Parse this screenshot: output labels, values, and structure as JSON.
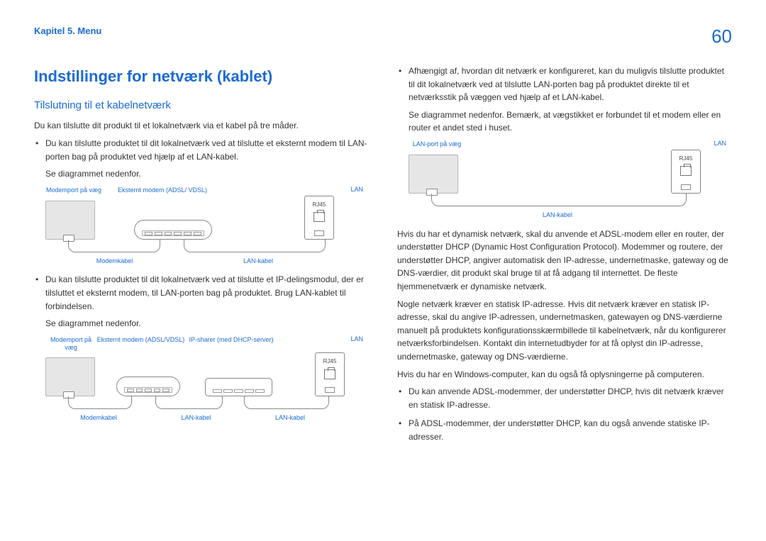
{
  "header": {
    "chapter": "Kapitel 5. Menu",
    "page": "60"
  },
  "left": {
    "h1": "Indstillinger for netværk (kablet)",
    "h2": "Tilslutning til et kabelnetværk",
    "intro": "Du kan tilslutte dit produkt til et lokalnetværk via et kabel på tre måder.",
    "b1": "Du kan tilslutte produktet til dit lokalnetværk ved at tilslutte et eksternt modem til LAN-porten bag på produktet ved hjælp af et LAN-kabel.",
    "see1": "Se diagrammet nedenfor.",
    "d1": {
      "wall": "Modemport på væg",
      "modem": "Eksternt modem (ADSL/ VDSL)",
      "lan": "LAN",
      "rj45": "RJ45",
      "cable1": "Modemkabel",
      "cable2": "LAN-kabel"
    },
    "b2": "Du kan tilslutte produktet til dit lokalnetværk ved at tilslutte et IP-delingsmodul, der er tilsluttet et eksternt modem, til LAN-porten bag på produktet. Brug LAN-kablet til forbindelsen.",
    "see2": "Se diagrammet nedenfor.",
    "d2": {
      "wall": "Modemport på væg",
      "modem": "Eksternt modem (ADSL/VDSL)",
      "sharer": "IP-sharer (med DHCP-server)",
      "lan": "LAN",
      "rj45": "RJ45",
      "cable1": "Modemkabel",
      "cable2": "LAN-kabel",
      "cable3": "LAN-kabel"
    }
  },
  "right": {
    "b1": "Afhængigt af, hvordan dit netværk er konfigureret, kan du muligvis tilslutte produktet til dit lokalnetværk ved at tilslutte LAN-porten bag på produktet direkte til et netværksstik på væggen ved hjælp af et LAN-kabel.",
    "see1": "Se diagrammet nedenfor. Bemærk, at vægstikket er forbundet til et modem eller en router et andet sted i huset.",
    "d3": {
      "wall": "LAN-port på væg",
      "lan": "LAN",
      "rj45": "RJ45",
      "cable1": "LAN-kabel"
    },
    "p_dhcp": "Hvis du har et dynamisk netværk, skal du anvende et ADSL-modem eller en router, der understøtter DHCP (Dynamic Host Configuration Protocol). Modemmer og routere, der understøtter DHCP, angiver automatisk den IP-adresse, undernetmaske, gateway og de DNS-værdier, dit produkt skal bruge til at få adgang til internettet. De fleste hjemmenetværk er dynamiske netværk.",
    "p_static": "Nogle netværk kræver en statisk IP-adresse. Hvis dit netværk kræver en statisk IP-adresse, skal du angive IP-adressen, undernetmasken, gatewayen og DNS-værdierne manuelt på produktets konfigurationsskærmbillede til kabelnetværk, når du konfigurerer netværksforbindelsen. Kontakt din internetudbyder for at få oplyst din IP-adresse, undernetmaske, gateway og DNS-værdierne.",
    "p_win": "Hvis du har en Windows-computer, kan du også få oplysningerne på computeren.",
    "b2": "Du kan anvende ADSL-modemmer, der understøtter DHCP, hvis dit netværk kræver en statisk IP-adresse.",
    "b3": "På ADSL-modemmer, der understøtter DHCP, kan du også anvende statiske IP-adresser."
  }
}
